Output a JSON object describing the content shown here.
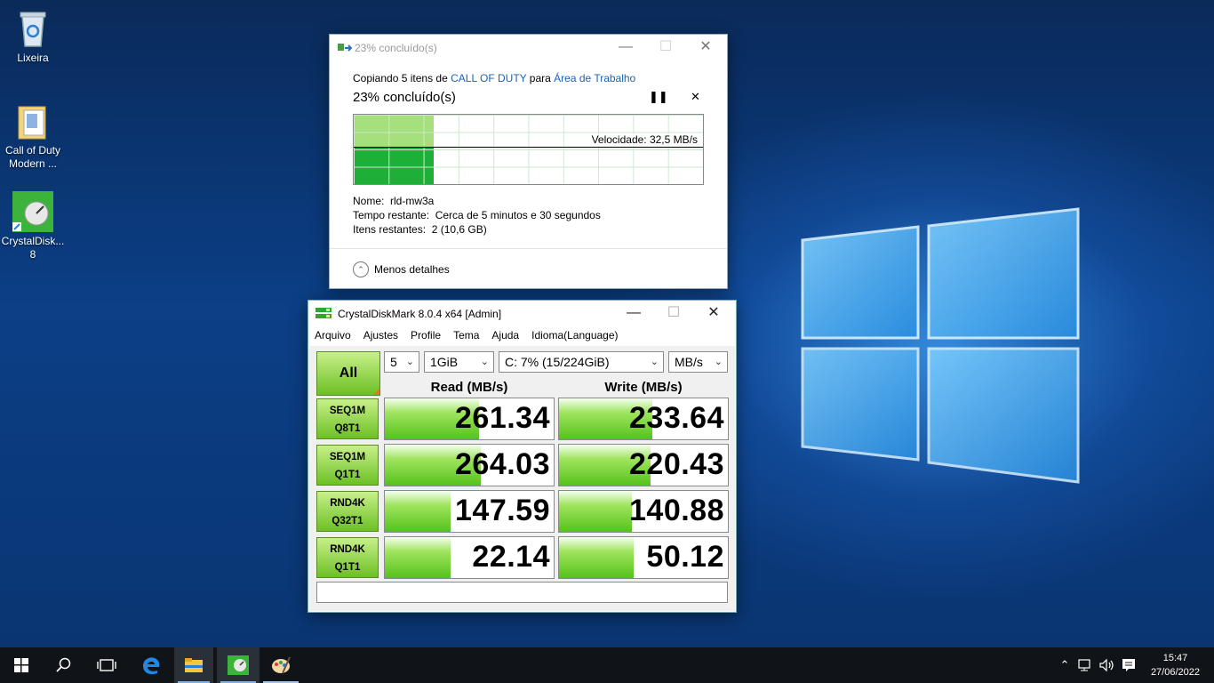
{
  "desktop": {
    "icons": [
      {
        "label": "Lixeira"
      },
      {
        "label": "Call of Duty Modern ..."
      },
      {
        "label": "CrystalDisk... 8"
      }
    ]
  },
  "copy_dialog": {
    "title": "23% concluído(s)",
    "copying_prefix": "Copiando 5 itens de",
    "source": "CALL OF DUTY",
    "para": "para",
    "destination": "Área de Trabalho",
    "percent_label": "23% concluído(s)",
    "progress_fraction": 0.23,
    "speed": "Velocidade: 32,5 MB/s",
    "name_label": "Nome:",
    "name_value": "rld-mw3a",
    "time_label": "Tempo restante:",
    "time_value": "Cerca de 5 minutos e 30 segundos",
    "items_label": "Itens restantes:",
    "items_value": "2 (10,6 GB)",
    "less_details": "Menos detalhes",
    "pause_icon": "pause-icon",
    "cancel_icon": "close-icon"
  },
  "cdm": {
    "title": "CrystalDiskMark 8.0.4 x64 [Admin]",
    "menu": [
      "Arquivo",
      "Ajustes",
      "Profile",
      "Tema",
      "Ajuda",
      "Idioma(Language)"
    ],
    "all_label": "All",
    "count": "5",
    "size": "1GiB",
    "drive": "C: 7% (15/224GiB)",
    "unit": "MB/s",
    "read_header": "Read (MB/s)",
    "write_header": "Write (MB/s)",
    "rows": [
      {
        "line1": "SEQ1M",
        "line2": "Q8T1",
        "read": "261.34",
        "write": "233.64",
        "read_fill": 0.56,
        "write_fill": 0.55
      },
      {
        "line1": "SEQ1M",
        "line2": "Q1T1",
        "read": "264.03",
        "write": "220.43",
        "read_fill": 0.57,
        "write_fill": 0.54
      },
      {
        "line1": "RND4K",
        "line2": "Q32T1",
        "read": "147.59",
        "write": "140.88",
        "read_fill": 0.39,
        "write_fill": 0.43
      },
      {
        "line1": "RND4K",
        "line2": "Q1T1",
        "read": "22.14",
        "write": "50.12",
        "read_fill": 0.39,
        "write_fill": 0.44
      }
    ],
    "accent": "#6cc024"
  },
  "taskbar": {
    "time": "15:47",
    "date": "27/06/2022"
  }
}
